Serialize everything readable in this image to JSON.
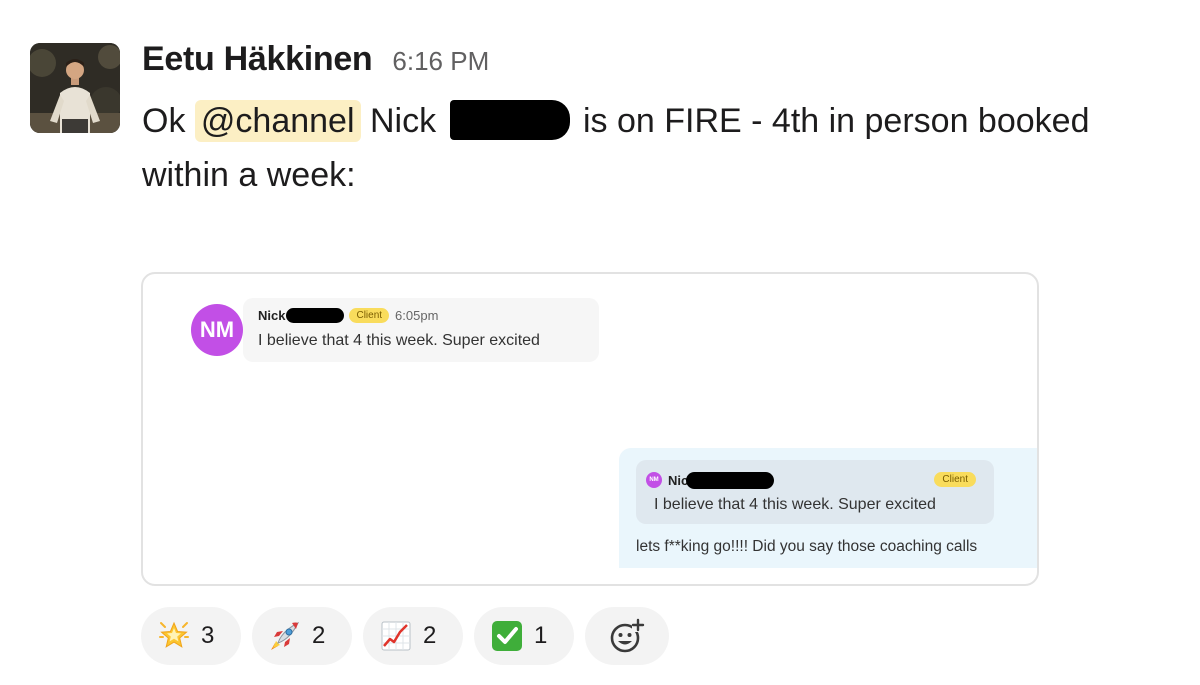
{
  "message": {
    "sender": "Eetu Häkkinen",
    "time": "6:16 PM",
    "text_before_mention": "Ok ",
    "mention": "@channel",
    "text_after_mention": " Nick ",
    "text_after_redaction": " is on FIRE - 4th in person booked within a week:"
  },
  "attachment": {
    "avatar_initials": "NM",
    "first_message": {
      "name": "Nick",
      "badge": "Client",
      "time": "6:05pm",
      "text": "I believe that 4 this week. Super excited"
    },
    "reply": {
      "mini_avatar_initials": "NM",
      "quoted_name": "Nic",
      "quoted_badge": "Client",
      "quoted_text": "I believe that 4 this week. Super excited",
      "text": "lets f**king go!!!! Did you say those coaching calls"
    }
  },
  "reactions": [
    {
      "emoji": "glowing-star",
      "count": "3"
    },
    {
      "emoji": "rocket",
      "count": "2"
    },
    {
      "emoji": "chart-increasing",
      "count": "2"
    },
    {
      "emoji": "check-mark-button",
      "count": "1"
    }
  ],
  "colors": {
    "mention_bg": "#fcefc4",
    "nm_avatar": "#c24fe6",
    "client_badge": "#f9dc5c",
    "reply_panel": "#eaf6fc",
    "reaction_bg": "#f3f3f3"
  }
}
